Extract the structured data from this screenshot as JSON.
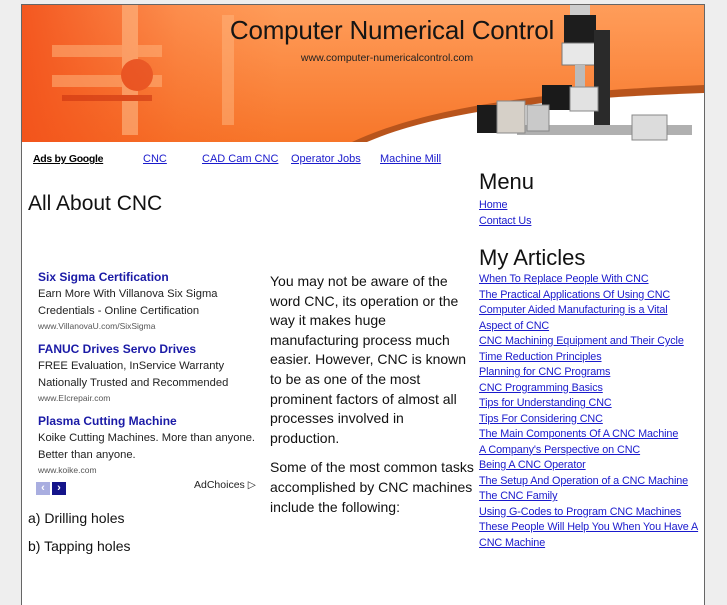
{
  "header": {
    "title": "Computer Numerical Control",
    "url": "www.computer-numericalcontrol.com"
  },
  "ad_links_bar": {
    "label": "Ads by Google",
    "links": [
      "CNC",
      "CAD Cam CNC",
      "Operator Jobs",
      "Machine Mill"
    ]
  },
  "page_title": "All About CNC",
  "ads": [
    {
      "title": "Six Sigma Certification",
      "desc": "Earn More With Villanova Six Sigma Credentials - Online Certification",
      "url": "www.VillanovaU.com/SixSigma"
    },
    {
      "title": "FANUC Drives Servo Drives",
      "desc": "FREE Evaluation, InService Warranty Nationally Trusted and Recommended",
      "url": "www.EIcrepair.com"
    },
    {
      "title": "Plasma Cutting Machine",
      "desc": "Koike Cutting Machines. More than anyone. Better than anyone.",
      "url": "www.koike.com"
    }
  ],
  "ad_nav": {
    "prev": "‹",
    "next": "›",
    "adchoices": "AdChoices ▷"
  },
  "body": {
    "paragraphs": [
      "You may not be aware of the word CNC, its operation or the way it makes huge manufacturing process much easier. However, CNC is known to be as one of the most prominent factors of almost all processes involved in production.",
      "Some of the most common tasks accomplished by CNC machines include the following:"
    ],
    "list": [
      "a) Drilling holes",
      "b) Tapping holes"
    ]
  },
  "sidebar": {
    "menu_heading": "Menu",
    "menu": [
      "Home",
      "Contact Us"
    ],
    "articles_heading": "My Articles",
    "articles": [
      "When To Replace People With CNC",
      "The Practical Applications Of Using CNC",
      "Computer Aided Manufacturing is a Vital Aspect of CNC",
      "CNC Machining Equipment and Their Cycle Time Reduction Principles",
      "Planning for CNC Programs",
      "CNC Programming Basics",
      "Tips for Understanding CNC",
      "Tips For Considering CNC",
      "The Main Components Of A CNC Machine",
      "A Company's Perspective on CNC",
      "Being A CNC Operator",
      "The Setup And Operation of a CNC Machine",
      "The CNC Family",
      "Using G-Codes to Program CNC Machines",
      "These People Will Help You When You Have A CNC Machine"
    ]
  }
}
